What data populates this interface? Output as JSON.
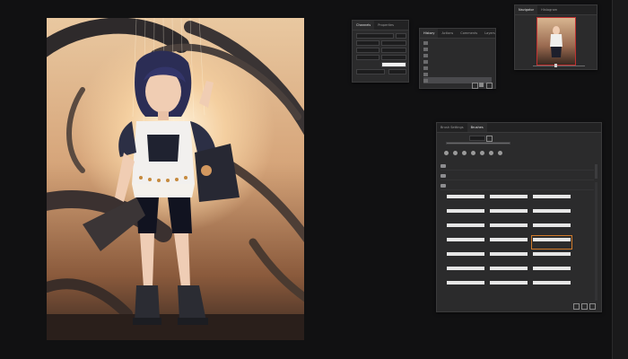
{
  "panels": {
    "channels": {
      "tabs": [
        "Channels",
        "Properties"
      ]
    },
    "history": {
      "tabs": [
        "History",
        "Actions",
        "Comments",
        "Layers"
      ]
    },
    "navigator": {
      "tabs": [
        "Navigator",
        "Histogram"
      ]
    },
    "brushes": {
      "tabs": [
        "Brush Settings",
        "Brushes"
      ]
    }
  },
  "colors": {
    "background": "#111112",
    "panel": "#2b2b2c",
    "selection": "#d07a2a"
  }
}
